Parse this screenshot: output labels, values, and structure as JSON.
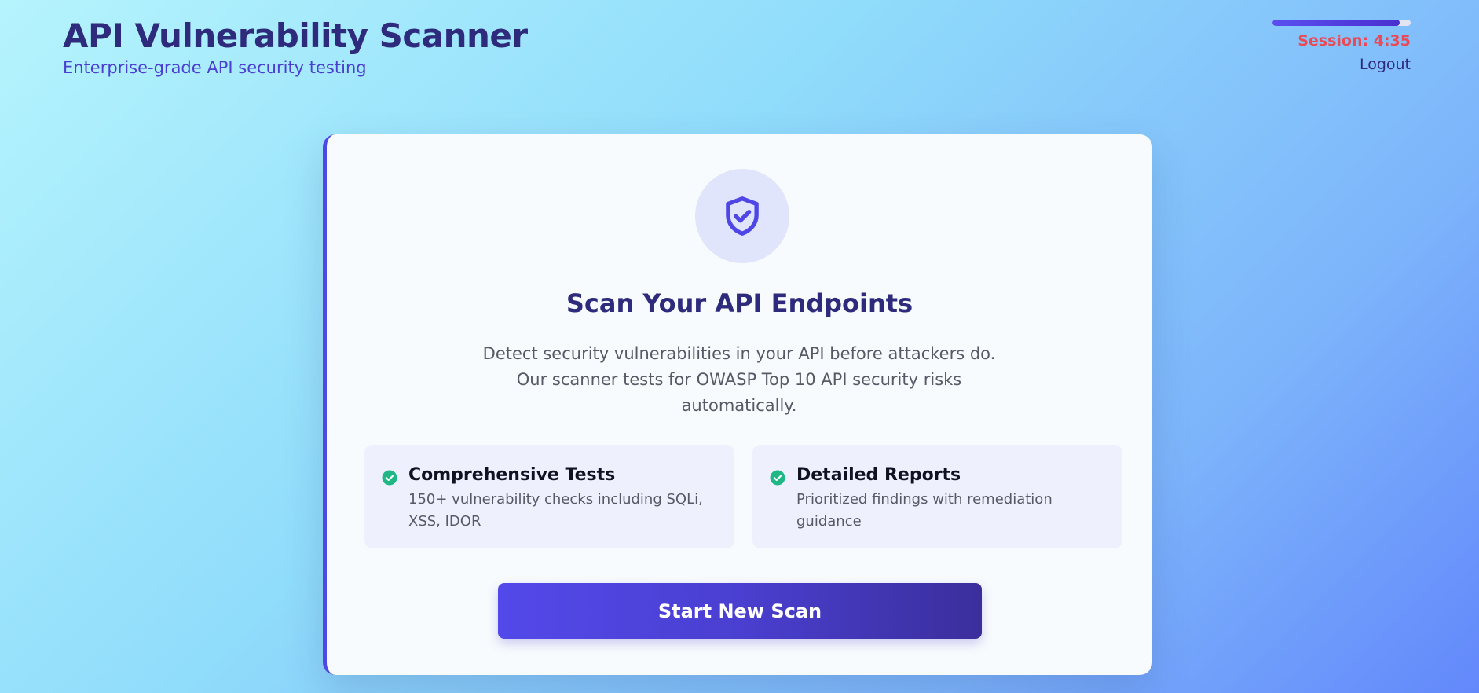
{
  "header": {
    "title": "API Vulnerability Scanner",
    "subtitle": "Enterprise-grade API security testing"
  },
  "session": {
    "label": "Session: 4:35",
    "remaining_fraction": 0.92,
    "logout_label": "Logout"
  },
  "card": {
    "icon": "shield-check-icon",
    "title": "Scan Your API Endpoints",
    "description_lines": [
      "Detect security vulnerabilities in your API before attackers do.",
      "Our scanner tests for OWASP Top 10 API security risks",
      "automatically."
    ],
    "features": [
      {
        "icon": "check-circle-icon",
        "title": "Comprehensive Tests",
        "desc_lines": [
          "150+ vulnerability checks including SQLi,",
          "XSS, IDOR"
        ]
      },
      {
        "icon": "check-circle-icon",
        "title": "Detailed Reports",
        "desc_lines": [
          "Prioritized findings with remediation",
          "guidance"
        ]
      }
    ],
    "button_label": "Start New Scan"
  },
  "colors": {
    "accent": "#5048e5",
    "title": "#2e2a7c",
    "session_warning": "#ea4a55",
    "check": "#1fb885"
  }
}
